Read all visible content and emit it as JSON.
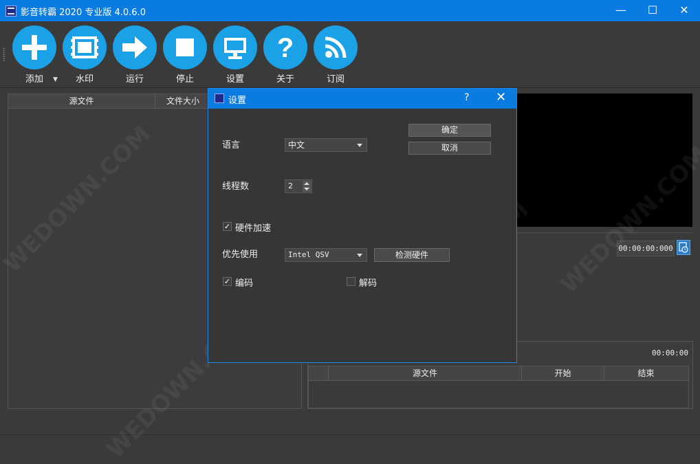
{
  "window": {
    "title": "影音转霸 2020 专业版 4.0.6.0",
    "minimize": "—",
    "maximize": "☐",
    "close": "✕"
  },
  "toolbar": {
    "items": [
      {
        "label": "添加",
        "icon": "plus-icon"
      },
      {
        "label": "水印",
        "icon": "film-icon"
      },
      {
        "label": "运行",
        "icon": "arrow-right-icon"
      },
      {
        "label": "停止",
        "icon": "stop-icon"
      },
      {
        "label": "设置",
        "icon": "monitor-icon"
      },
      {
        "label": "关于",
        "icon": "question-icon"
      },
      {
        "label": "订阅",
        "icon": "rss-icon"
      }
    ],
    "dropdown_arrow": "▼"
  },
  "file_table": {
    "columns": [
      "源文件",
      "文件大小"
    ]
  },
  "time_display": "00:00:00:000",
  "segment_panel": {
    "time": "00:00:00",
    "columns": [
      "源文件",
      "开始",
      "结束"
    ]
  },
  "dialog": {
    "title": "设置",
    "help": "?",
    "close": "✕",
    "ok": "确定",
    "cancel": "取消",
    "language_label": "语言",
    "language_value": "中文",
    "threads_label": "线程数",
    "threads_value": "2",
    "hw_accel_label": "硬件加速",
    "hw_accel_checked": true,
    "prefer_label": "优先使用",
    "prefer_value": "Intel QSV",
    "detect_button": "检测硬件",
    "encode_label": "编码",
    "encode_checked": true,
    "decode_label": "解码",
    "decode_checked": false,
    "check_mark": "✓"
  },
  "watermark_text": "WEDOWN.COM",
  "colors": {
    "accent": "#0a7be0",
    "tool_circle": "#1ba1e6",
    "background": "#3a3a3a"
  }
}
